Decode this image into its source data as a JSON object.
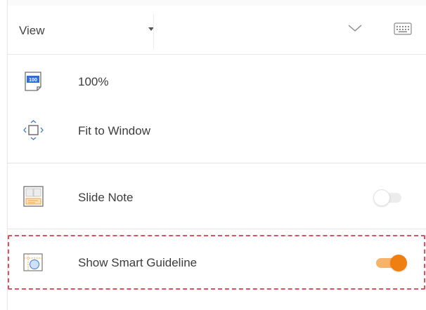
{
  "header": {
    "view_label": "View",
    "collapse_icon": "chevron-down-icon",
    "keyboard_icon": "keyboard-icon"
  },
  "zoom_options": [
    {
      "label": "100%",
      "icon": "zoom-100-icon"
    },
    {
      "label": "Fit to Window",
      "icon": "fit-to-window-icon"
    }
  ],
  "toggles": [
    {
      "label": "Slide Note",
      "icon": "slide-note-icon",
      "enabled": false
    },
    {
      "label": "Show Smart Guideline",
      "icon": "smart-guideline-icon",
      "enabled": true,
      "highlighted": true
    }
  ],
  "colors": {
    "accent": "#f07f12",
    "accent_track": "#f6b46a",
    "highlight_border": "#d9535f",
    "icon_blue": "#3a7bd5",
    "icon_orange": "#f2a23c"
  }
}
